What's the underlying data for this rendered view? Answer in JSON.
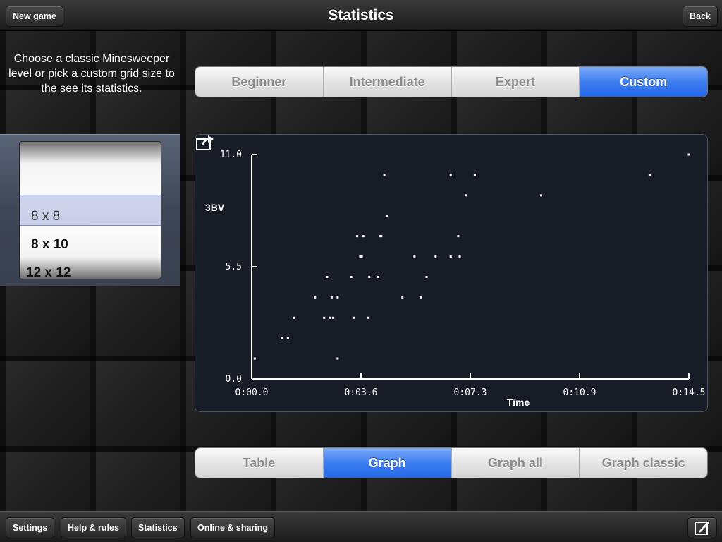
{
  "header": {
    "title": "Statistics",
    "new_game_label": "New game",
    "back_label": "Back"
  },
  "instructions": "Choose a classic Minesweeper level or pick a custom grid size to the see its statistics.",
  "picker": {
    "items": [
      "8 x 8",
      "8 x 10",
      "12 x 12"
    ],
    "selected": "8 x 8"
  },
  "level_tabs": {
    "items": [
      "Beginner",
      "Intermediate",
      "Expert",
      "Custom"
    ],
    "active": "Custom"
  },
  "view_tabs": {
    "items": [
      "Table",
      "Graph",
      "Graph all",
      "Graph classic"
    ],
    "active": "Graph"
  },
  "footer": {
    "settings_label": "Settings",
    "help_label": "Help & rules",
    "statistics_label": "Statistics",
    "online_label": "Online & sharing"
  },
  "icons": {
    "share": "share-icon",
    "compose": "compose-icon"
  },
  "colors": {
    "accent": "#2f74ec",
    "chart_bg": "#171c27",
    "point": "#ffffff"
  },
  "chart_data": {
    "type": "scatter",
    "xlabel": "Time",
    "ylabel": "3BV",
    "x_ticks": [
      "0:00.0",
      "0:03.6",
      "0:07.3",
      "0:10.9",
      "0:14.5"
    ],
    "y_ticks": [
      "0.0",
      "5.5",
      "11.0"
    ],
    "xlim": [
      0,
      14.5
    ],
    "ylim": [
      0,
      11
    ],
    "points": [
      [
        0.1,
        1
      ],
      [
        1.0,
        2
      ],
      [
        1.2,
        2
      ],
      [
        1.4,
        3
      ],
      [
        2.1,
        4
      ],
      [
        2.4,
        3
      ],
      [
        2.5,
        5
      ],
      [
        2.6,
        3
      ],
      [
        2.65,
        4
      ],
      [
        2.7,
        3
      ],
      [
        2.85,
        4
      ],
      [
        2.85,
        1
      ],
      [
        3.3,
        5
      ],
      [
        3.4,
        3
      ],
      [
        3.5,
        7
      ],
      [
        3.6,
        6
      ],
      [
        3.65,
        6
      ],
      [
        3.7,
        7
      ],
      [
        3.85,
        3
      ],
      [
        3.9,
        5
      ],
      [
        4.2,
        5
      ],
      [
        4.25,
        7
      ],
      [
        4.3,
        7
      ],
      [
        4.4,
        10
      ],
      [
        4.5,
        8
      ],
      [
        5.0,
        4
      ],
      [
        5.4,
        6
      ],
      [
        5.6,
        4
      ],
      [
        5.8,
        5
      ],
      [
        6.1,
        6
      ],
      [
        6.6,
        10
      ],
      [
        6.6,
        6
      ],
      [
        6.85,
        7
      ],
      [
        6.9,
        6
      ],
      [
        7.1,
        9
      ],
      [
        7.4,
        10
      ],
      [
        9.6,
        9
      ],
      [
        13.2,
        10
      ],
      [
        14.5,
        11
      ]
    ]
  }
}
